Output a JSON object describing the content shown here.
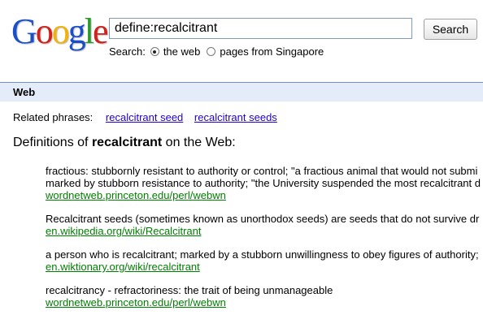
{
  "logo": {
    "letters": [
      "G",
      "o",
      "o",
      "g",
      "l",
      "e"
    ],
    "colors": [
      "#1a4fc9",
      "#d0211a",
      "#f2b10a",
      "#1a4fc9",
      "#2a9a2a",
      "#d0211a"
    ]
  },
  "search": {
    "query": "define:recalcitrant",
    "button_label": "Search",
    "scope_label": "Search:",
    "option_web": "the web",
    "option_country": "pages from Singapore"
  },
  "webbar": {
    "label": "Web"
  },
  "related": {
    "label": "Related phrases:",
    "links": [
      "recalcitrant seed",
      "recalcitrant seeds"
    ]
  },
  "heading": {
    "prefix": "Definitions of",
    "term": "recalcitrant",
    "suffix": "on the Web:"
  },
  "definitions": [
    {
      "items": [
        "fractious: stubbornly resistant to authority or control; \"a fractious animal that would not submi",
        "marked by stubborn resistance to authority; \"the University suspended the most recalcitrant d"
      ],
      "source": "wordnetweb.princeton.edu/perl/webwn"
    },
    {
      "items": [
        "Recalcitrant seeds (sometimes known as unorthodox seeds) are seeds that do not survive dr"
      ],
      "source": "en.wikipedia.org/wiki/Recalcitrant"
    },
    {
      "items": [
        "a person who is recalcitrant; marked by a stubborn unwillingness to obey figures of authority;"
      ],
      "source": "en.wiktionary.org/wiki/recalcitrant"
    },
    {
      "items": [
        "recalcitrancy - refractoriness: the trait of being unmanageable"
      ],
      "source": "wordnetweb.princeton.edu/perl/webwn"
    }
  ],
  "colors": {
    "link": "#2200cc",
    "source": "#008000",
    "webbar_bg": "#e5ecf9",
    "webbar_border": "#6b90da"
  }
}
